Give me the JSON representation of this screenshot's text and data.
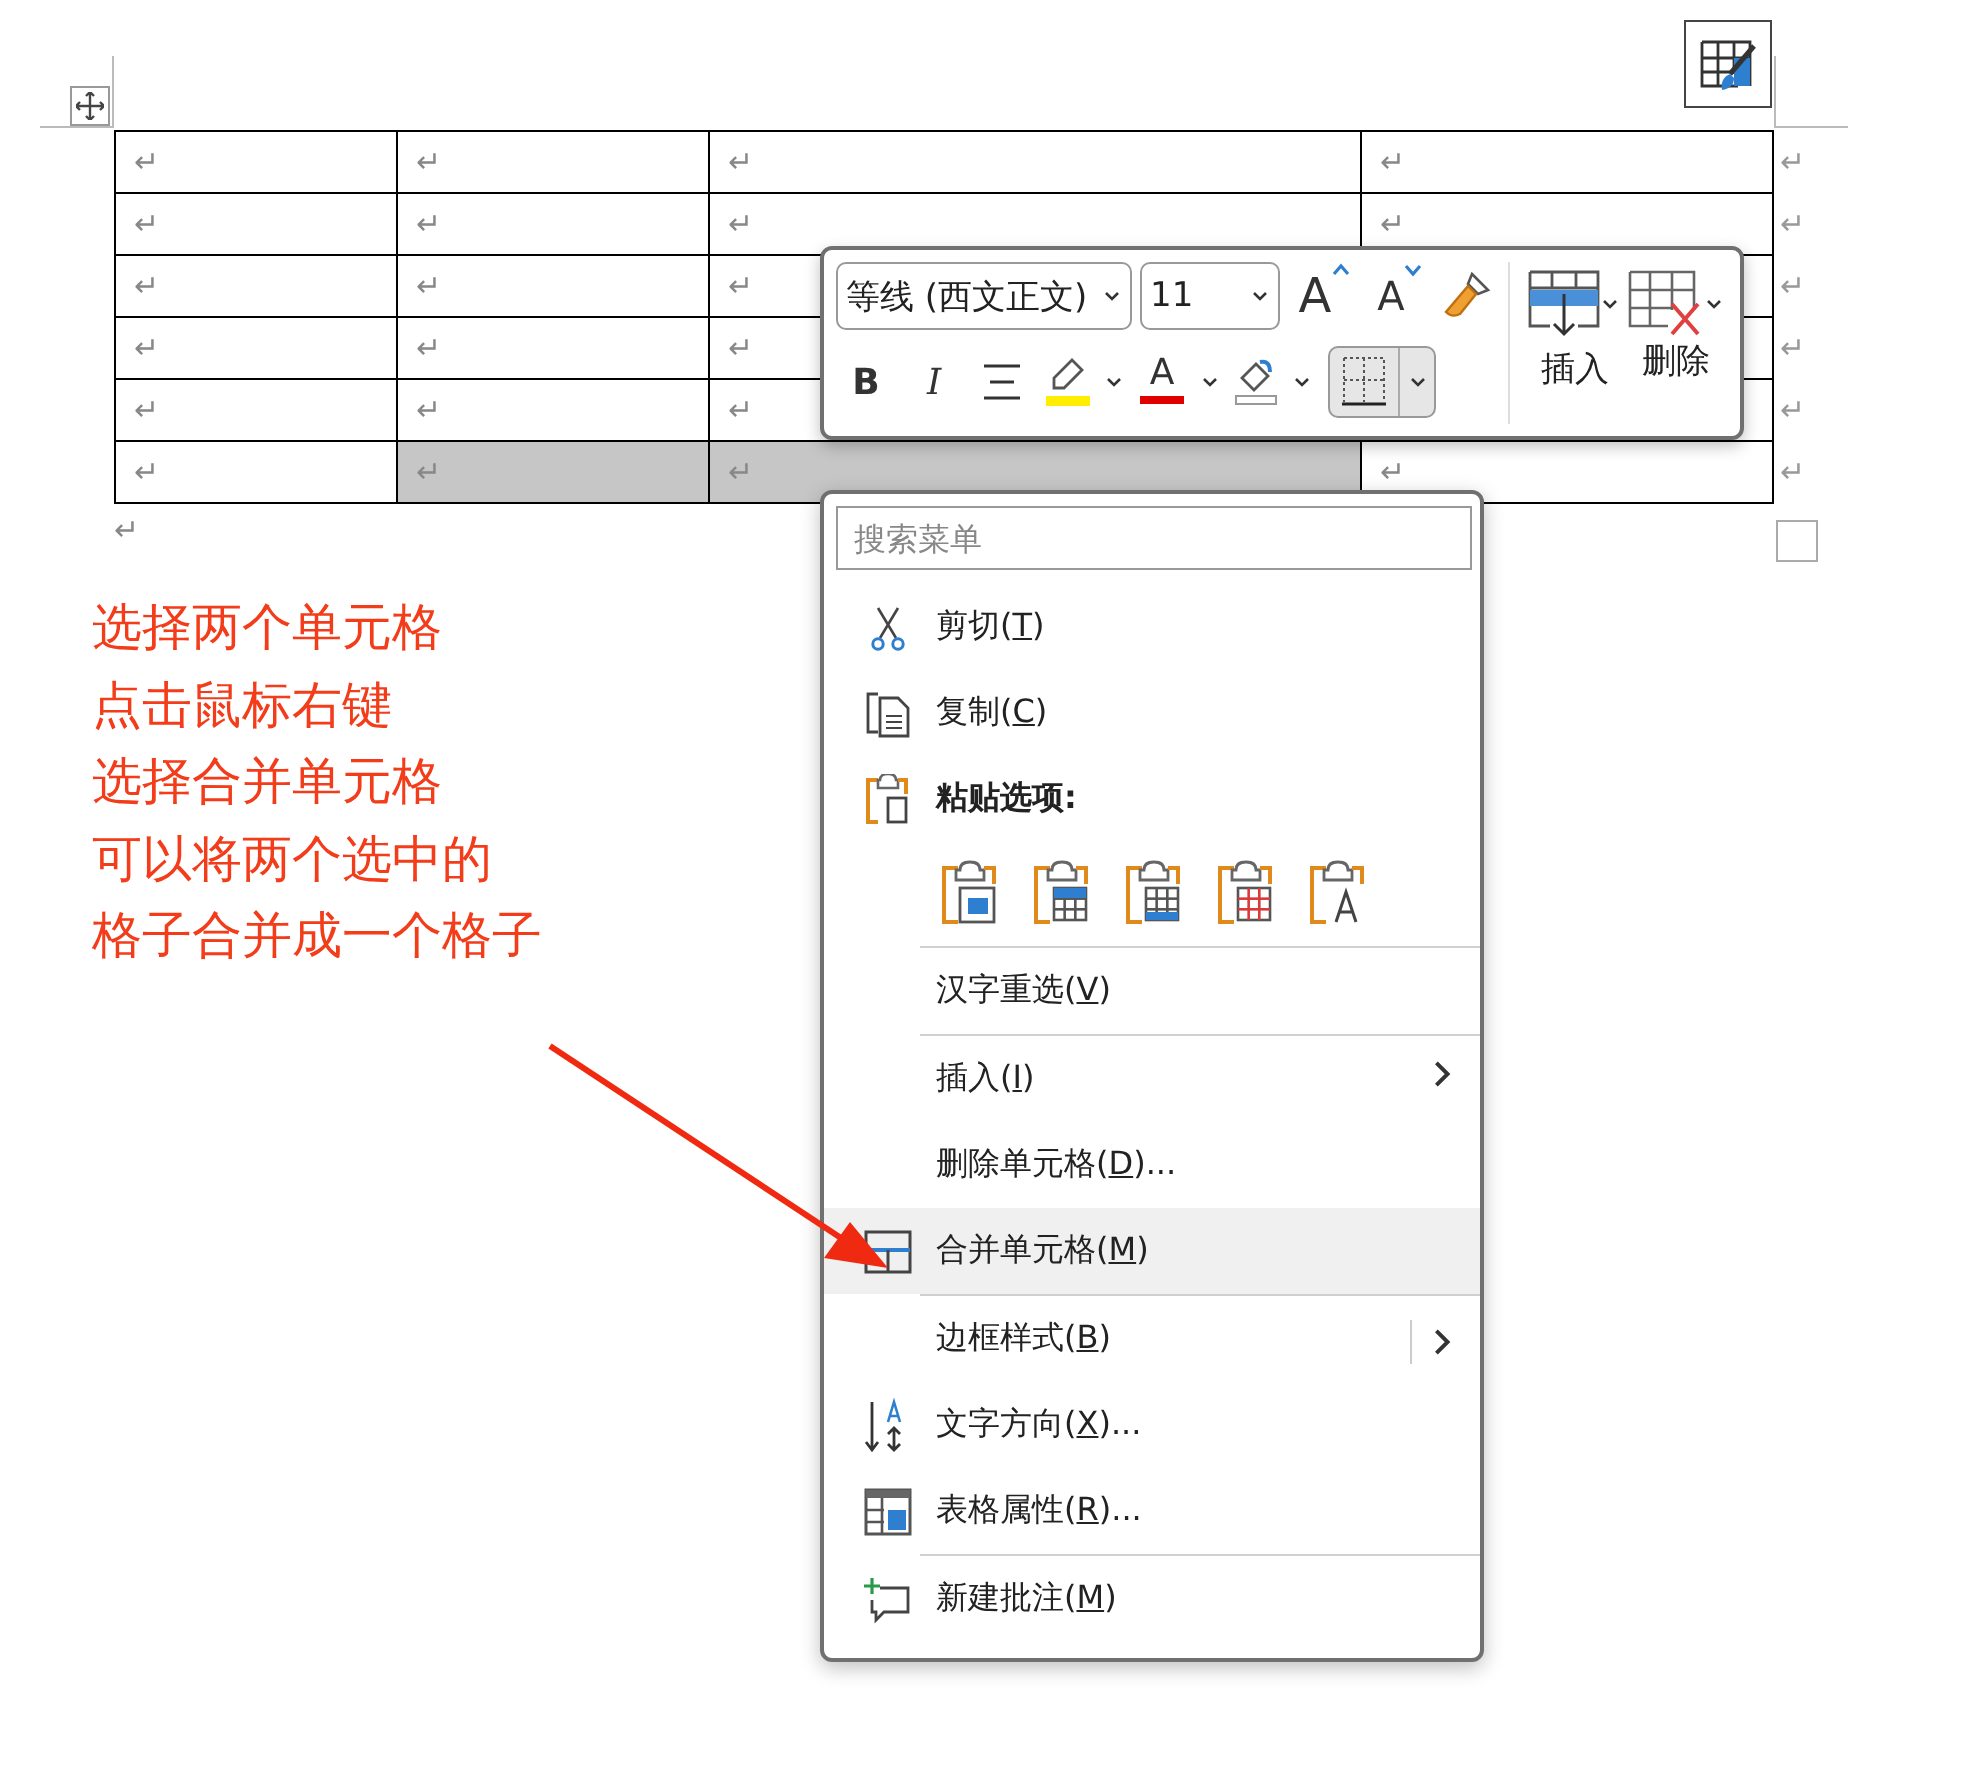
{
  "table": {
    "rows": [
      {
        "cells": [
          {
            "mark": "↵",
            "selected": false
          },
          {
            "mark": "↵",
            "selected": false
          },
          {
            "mark": "↵",
            "selected": false
          },
          {
            "mark": "↵",
            "selected": false
          }
        ],
        "end_mark": "↵"
      },
      {
        "cells": [
          {
            "mark": "↵",
            "selected": false
          },
          {
            "mark": "↵",
            "selected": false
          },
          {
            "mark": "↵",
            "selected": false
          },
          {
            "mark": "↵",
            "selected": false
          }
        ],
        "end_mark": "↵"
      },
      {
        "cells": [
          {
            "mark": "↵",
            "selected": false
          },
          {
            "mark": "↵",
            "selected": false
          },
          {
            "mark": "↵",
            "selected": false
          },
          {
            "selected": false
          }
        ],
        "end_mark": "↵"
      },
      {
        "cells": [
          {
            "mark": "↵",
            "selected": false
          },
          {
            "mark": "↵",
            "selected": false
          },
          {
            "mark": "↵",
            "selected": false
          },
          {
            "selected": false
          }
        ],
        "end_mark": "↵"
      },
      {
        "cells": [
          {
            "mark": "↵",
            "selected": false
          },
          {
            "mark": "↵",
            "selected": false
          },
          {
            "mark": "↵",
            "selected": false
          },
          {
            "selected": false
          }
        ],
        "end_mark": "↵"
      },
      {
        "cells": [
          {
            "mark": "↵",
            "selected": false
          },
          {
            "mark": "↵",
            "selected": true
          },
          {
            "mark": "↵",
            "selected": true
          },
          {
            "mark": "↵",
            "selected": false
          }
        ],
        "end_mark": "↵"
      }
    ],
    "after_mark": "↵"
  },
  "annotation": {
    "lines": [
      "选择两个单元格",
      "点击鼠标右键",
      "选择合并单元格",
      "可以将两个选中的",
      "格子合并成一个格子"
    ]
  },
  "mini_toolbar": {
    "font": "等线 (西文正文)",
    "size": "11",
    "grow_font": "A",
    "shrink_font": "A",
    "bold": "B",
    "italic": "I",
    "font_color": "A",
    "insert": "插入",
    "delete": "删除"
  },
  "context_menu": {
    "search": {
      "placeholder": "搜索菜单"
    },
    "items": [
      {
        "kind": "command",
        "before": "剪切(",
        "key": "T",
        "after": ")",
        "submenu": false,
        "split": false,
        "selected": false
      },
      {
        "kind": "command",
        "before": "复制(",
        "key": "C",
        "after": ")",
        "submenu": false,
        "split": false,
        "selected": false
      },
      {
        "kind": "heading",
        "label": "粘贴选项:"
      },
      {
        "kind": "paste_options"
      },
      {
        "kind": "separator"
      },
      {
        "kind": "command",
        "before": "汉字重选(",
        "key": "V",
        "after": ")",
        "submenu": false,
        "split": false,
        "selected": false
      },
      {
        "kind": "separator"
      },
      {
        "kind": "command",
        "before": "插入(",
        "key": "I",
        "after": ")",
        "submenu": true,
        "split": false,
        "selected": false
      },
      {
        "kind": "command",
        "before": "删除单元格(",
        "key": "D",
        "after": ")...",
        "submenu": false,
        "split": false,
        "selected": false
      },
      {
        "kind": "command",
        "before": "合并单元格(",
        "key": "M",
        "after": ")",
        "submenu": false,
        "split": false,
        "selected": true
      },
      {
        "kind": "separator"
      },
      {
        "kind": "command",
        "before": "边框样式(",
        "key": "B",
        "after": ")",
        "submenu": true,
        "split": true,
        "selected": false
      },
      {
        "kind": "command",
        "before": "文字方向(",
        "key": "X",
        "after": ")...",
        "submenu": false,
        "split": false,
        "selected": false
      },
      {
        "kind": "command",
        "before": "表格属性(",
        "key": "R",
        "after": ")...",
        "submenu": false,
        "split": false,
        "selected": false
      },
      {
        "kind": "separator"
      },
      {
        "kind": "command",
        "before": "新建批注(",
        "key": "M",
        "after": ")",
        "submenu": false,
        "split": false,
        "selected": false
      }
    ]
  }
}
